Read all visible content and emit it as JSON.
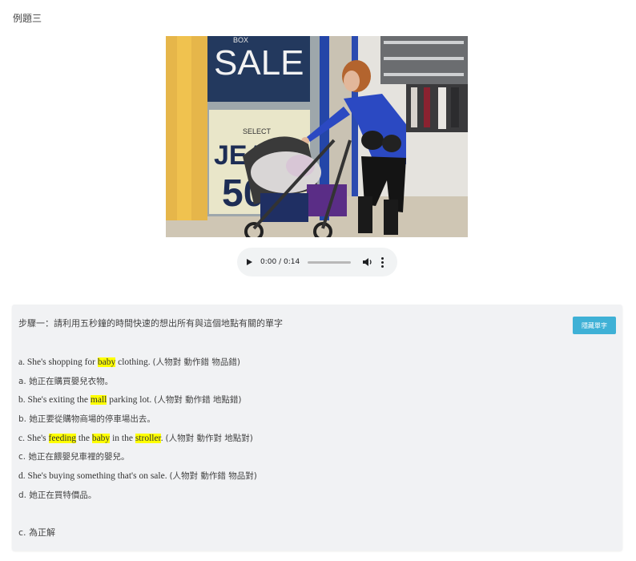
{
  "page": {
    "example_title": "例題三"
  },
  "photo": {
    "sign_top": "SALE",
    "sign_small": "BOX",
    "sign_select": "SELECT",
    "sign_jeans": "JEANS",
    "sign_number": "50"
  },
  "audio": {
    "time": "0:00 / 0:14",
    "progress": 0.0
  },
  "panel": {
    "step_text": "步驟一：請利用五秒鐘的時間快速的想出所有與這個地點有關的單字",
    "hide_button": "隱藏單字",
    "lines": [
      {
        "label": "a. She's shopping for ",
        "kw1": "baby",
        "rest1": " clothing. ",
        "note": "(人物對 動作錯 物品錯)"
      },
      {
        "zh": "a. 她正在購買嬰兒衣物。"
      },
      {
        "label": "b. She's exiting the ",
        "kw1": "mall",
        "rest1": " parking lot. ",
        "note": "(人物對 動作錯 地點錯)"
      },
      {
        "zh": "b. 她正要從購物商場的停車場出去。"
      },
      {
        "label": "c. She's ",
        "kw1": "feeding",
        "mid": " the ",
        "kw2": "baby",
        "mid2": " in the ",
        "kw3": "stroller",
        "rest1": ". ",
        "note": "(人物對 動作對 地點對)"
      },
      {
        "zh": "c. 她正在餵嬰兒車裡的嬰兒。"
      },
      {
        "label": "d. She's buying something that's on sale. ",
        "note": "(人物對 動作錯 物品對)"
      },
      {
        "zh": "d. 她正在買特價品。"
      }
    ],
    "answer": "c. 為正解"
  },
  "colors": {
    "highlight": "#ffff00",
    "button": "#3fb1d6",
    "panel_bg": "#f1f2f4"
  }
}
